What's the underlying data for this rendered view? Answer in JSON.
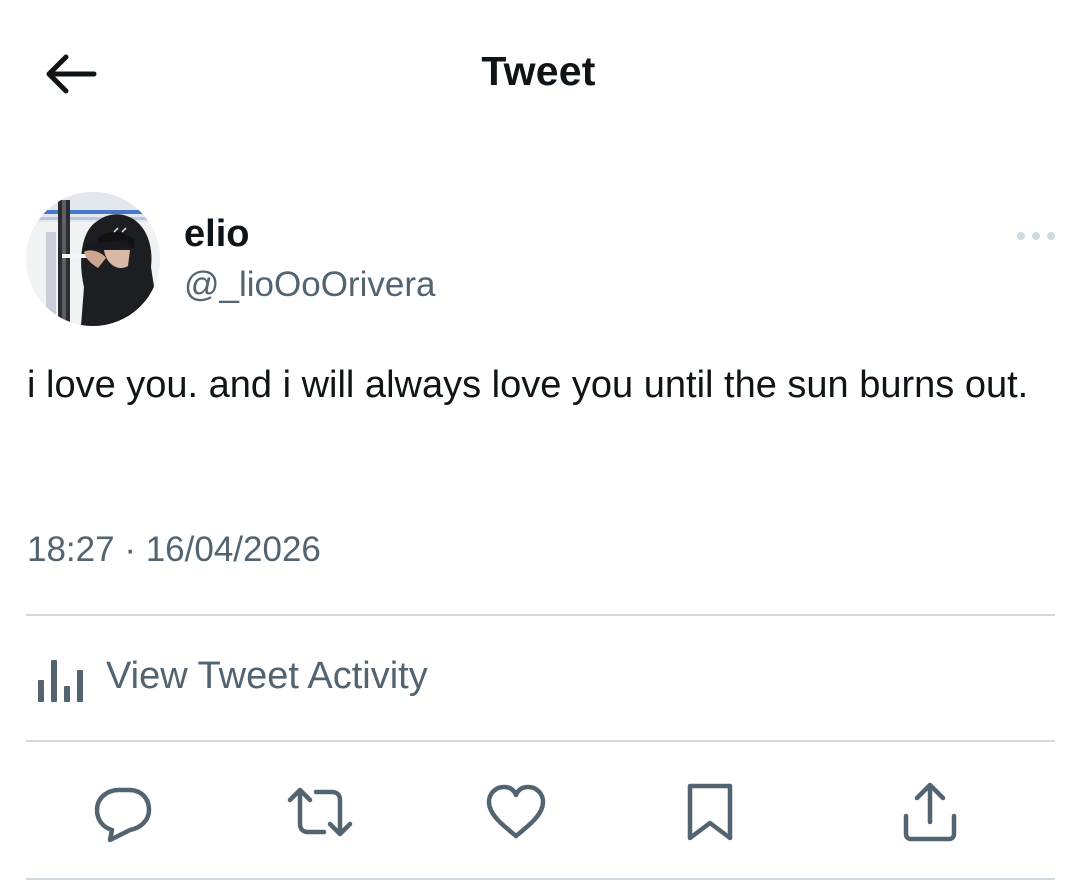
{
  "header": {
    "title": "Tweet"
  },
  "icons": {
    "back": "arrow-left-icon",
    "more": "more-horizontal-icon",
    "activity": "bar-chart-icon",
    "reply": "reply-icon",
    "retweet": "retweet-icon",
    "like": "heart-icon",
    "bookmark": "bookmark-icon",
    "share": "share-icon"
  },
  "tweet": {
    "author_name": "elio",
    "author_handle": "@_lioOoOrivera",
    "text": "i love you. and i will always love you until the sun burns out.",
    "time": "18:27",
    "separator": "·",
    "date": "16/04/2026"
  },
  "activity": {
    "label": "View Tweet Activity"
  },
  "colors": {
    "text_primary": "#0f1419",
    "text_secondary": "#536471",
    "divider": "#cfd9de"
  }
}
